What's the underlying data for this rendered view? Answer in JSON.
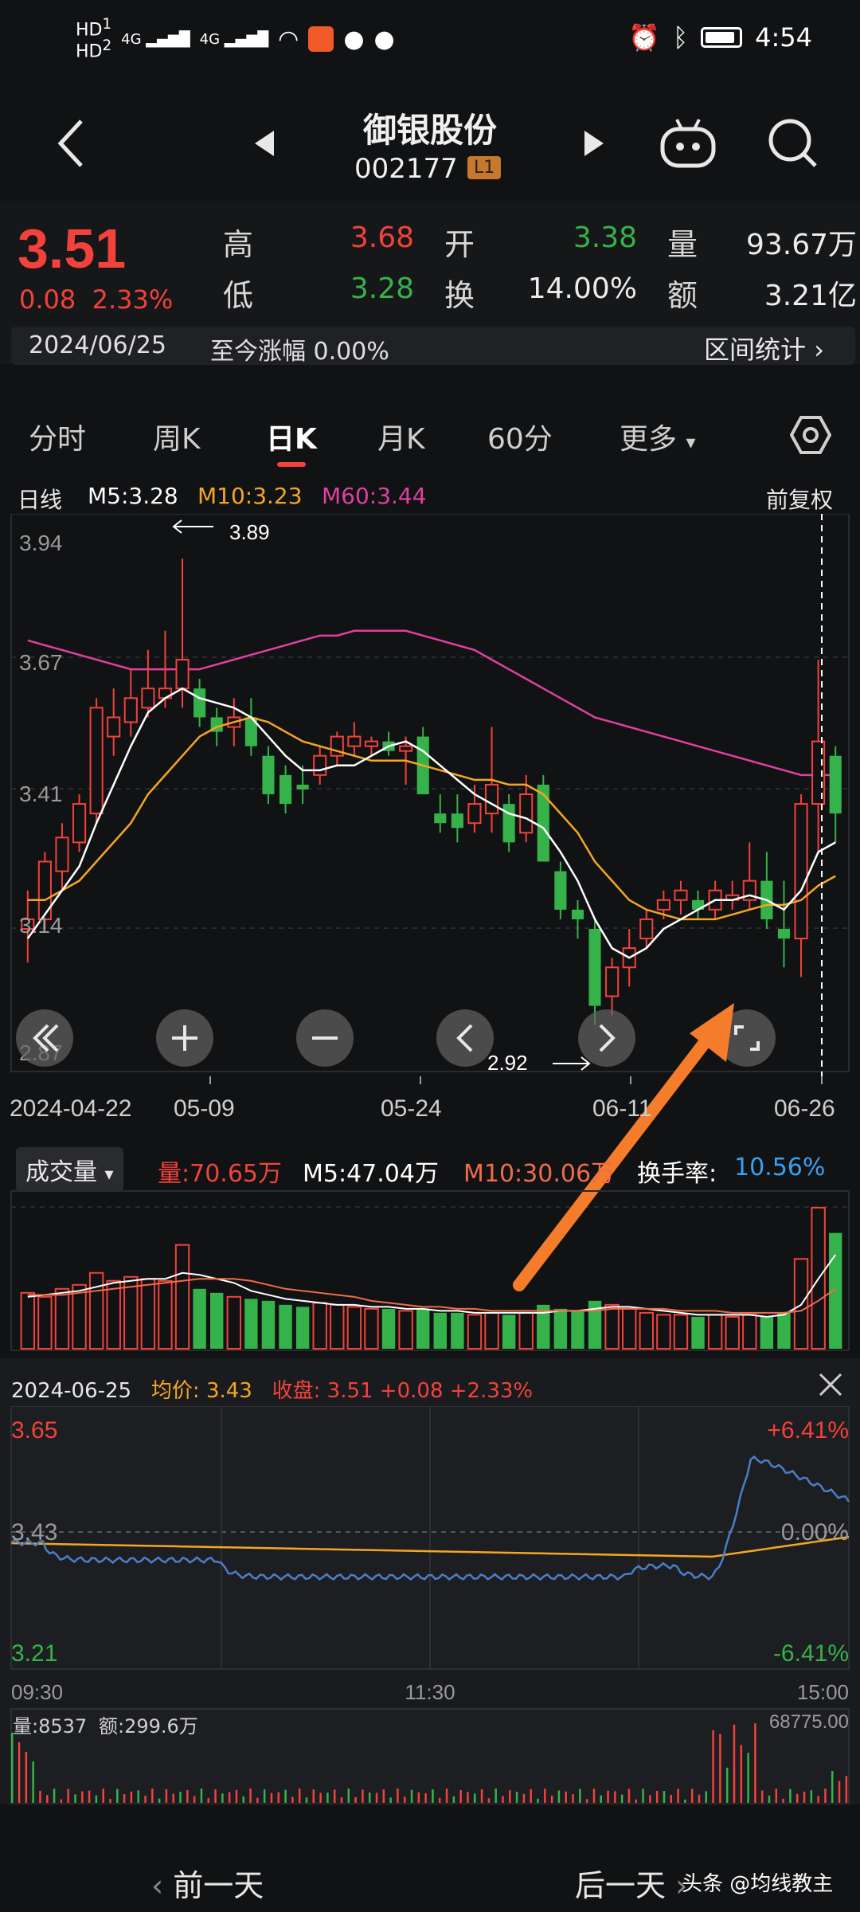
{
  "status_bar": {
    "time": "4:54",
    "network_1": "HD",
    "network_2": "4G",
    "sim1": "1",
    "sim2": "2"
  },
  "header": {
    "stock_name": "御银股份",
    "stock_code": "002177",
    "level_badge": "L1"
  },
  "quote": {
    "price": "3.51",
    "change": "0.08",
    "change_pct": "2.33%",
    "labels": {
      "high": "高",
      "low": "低",
      "open": "开",
      "turnover": "换",
      "volume": "量",
      "amount": "额"
    },
    "high": "3.68",
    "low": "3.28",
    "open": "3.38",
    "turnover_rate": "14.00%",
    "volume": "93.67万",
    "amount": "3.21亿",
    "date": "2024/06/25",
    "since_change": "至今涨幅 0.00%",
    "range_stats": "区间统计"
  },
  "tabs": {
    "items": [
      "分时",
      "周K",
      "日K",
      "月K",
      "60分",
      "更多"
    ],
    "active": "日K"
  },
  "ma_legend": {
    "label": "日线",
    "m5": "M5:3.28",
    "m10": "M10:3.23",
    "m60": "M60:3.44",
    "adjust": "前复权"
  },
  "kline": {
    "y_labels": [
      "3.94",
      "3.67",
      "3.41",
      "3.14",
      "2.87"
    ],
    "x_labels": [
      "2024-04-22",
      "05-09",
      "05-24",
      "06-11",
      "06-26"
    ],
    "max_annotation": "3.89",
    "min_annotation": "2.92"
  },
  "volume_panel": {
    "selector": "成交量",
    "vol": "量:70.65万",
    "m5": "M5:47.04万",
    "m10": "M10:30.06万",
    "turnover_label": "换手率:",
    "turnover_value": "10.56%"
  },
  "intraday": {
    "date": "2024-06-25",
    "avg_label": "均价:",
    "avg_value": "3.43",
    "close_label": "收盘:",
    "close_value": "3.51 +0.08 +2.33%",
    "y_top": "3.65",
    "y_mid": "3.43",
    "y_bot": "3.21",
    "pct_top": "+6.41%",
    "pct_mid": "0.00%",
    "pct_bot": "-6.41%",
    "t_start": "09:30",
    "t_mid": "11:30",
    "t_end": "15:00",
    "vol_label": "量:8537",
    "amount_label": "额:299.6万",
    "vol_max": "68775.00"
  },
  "bottom_nav": {
    "prev": "前一天",
    "next": "后一天",
    "watermark": "头条 @均线教主"
  },
  "colors": {
    "up": "#f2423b",
    "down": "#35b34a",
    "m5": "#ffffff",
    "m10": "#f5a623",
    "m60": "#e040a0",
    "intraday_price": "#4a7fc8",
    "intraday_avg": "#f5a623"
  },
  "chart_data": {
    "type": "candlestick",
    "candles": [
      {
        "o": 3.12,
        "h": 3.2,
        "l": 3.05,
        "c": 3.14
      },
      {
        "o": 3.14,
        "h": 3.28,
        "l": 3.12,
        "c": 3.26
      },
      {
        "o": 3.24,
        "h": 3.34,
        "l": 3.2,
        "c": 3.31
      },
      {
        "o": 3.3,
        "h": 3.4,
        "l": 3.28,
        "c": 3.38
      },
      {
        "o": 3.36,
        "h": 3.6,
        "l": 3.34,
        "c": 3.58
      },
      {
        "o": 3.52,
        "h": 3.62,
        "l": 3.48,
        "c": 3.56
      },
      {
        "o": 3.55,
        "h": 3.66,
        "l": 3.52,
        "c": 3.6
      },
      {
        "o": 3.58,
        "h": 3.7,
        "l": 3.56,
        "c": 3.62
      },
      {
        "o": 3.6,
        "h": 3.74,
        "l": 3.58,
        "c": 3.62
      },
      {
        "o": 3.62,
        "h": 3.89,
        "l": 3.58,
        "c": 3.68
      },
      {
        "o": 3.62,
        "h": 3.64,
        "l": 3.54,
        "c": 3.56
      },
      {
        "o": 3.56,
        "h": 3.58,
        "l": 3.5,
        "c": 3.53
      },
      {
        "o": 3.54,
        "h": 3.6,
        "l": 3.5,
        "c": 3.56
      },
      {
        "o": 3.56,
        "h": 3.6,
        "l": 3.48,
        "c": 3.5
      },
      {
        "o": 3.48,
        "h": 3.5,
        "l": 3.38,
        "c": 3.4
      },
      {
        "o": 3.44,
        "h": 3.46,
        "l": 3.36,
        "c": 3.38
      },
      {
        "o": 3.42,
        "h": 3.46,
        "l": 3.38,
        "c": 3.41
      },
      {
        "o": 3.44,
        "h": 3.5,
        "l": 3.42,
        "c": 3.48
      },
      {
        "o": 3.48,
        "h": 3.53,
        "l": 3.46,
        "c": 3.52
      },
      {
        "o": 3.5,
        "h": 3.55,
        "l": 3.48,
        "c": 3.52
      },
      {
        "o": 3.5,
        "h": 3.52,
        "l": 3.48,
        "c": 3.51
      },
      {
        "o": 3.51,
        "h": 3.53,
        "l": 3.48,
        "c": 3.49
      },
      {
        "o": 3.49,
        "h": 3.52,
        "l": 3.42,
        "c": 3.5
      },
      {
        "o": 3.52,
        "h": 3.54,
        "l": 3.44,
        "c": 3.4
      },
      {
        "o": 3.36,
        "h": 3.4,
        "l": 3.32,
        "c": 3.34
      },
      {
        "o": 3.36,
        "h": 3.4,
        "l": 3.3,
        "c": 3.33
      },
      {
        "o": 3.34,
        "h": 3.42,
        "l": 3.32,
        "c": 3.38
      },
      {
        "o": 3.36,
        "h": 3.54,
        "l": 3.32,
        "c": 3.42
      },
      {
        "o": 3.38,
        "h": 3.4,
        "l": 3.28,
        "c": 3.3
      },
      {
        "o": 3.32,
        "h": 3.44,
        "l": 3.3,
        "c": 3.4
      },
      {
        "o": 3.42,
        "h": 3.44,
        "l": 3.28,
        "c": 3.26
      },
      {
        "o": 3.24,
        "h": 3.26,
        "l": 3.14,
        "c": 3.16
      },
      {
        "o": 3.16,
        "h": 3.18,
        "l": 3.1,
        "c": 3.14
      },
      {
        "o": 3.12,
        "h": 3.14,
        "l": 2.92,
        "c": 2.96
      },
      {
        "o": 2.98,
        "h": 3.06,
        "l": 2.94,
        "c": 3.04
      },
      {
        "o": 3.04,
        "h": 3.12,
        "l": 3.0,
        "c": 3.08
      },
      {
        "o": 3.1,
        "h": 3.16,
        "l": 3.08,
        "c": 3.14
      },
      {
        "o": 3.16,
        "h": 3.2,
        "l": 3.14,
        "c": 3.18
      },
      {
        "o": 3.18,
        "h": 3.22,
        "l": 3.15,
        "c": 3.2
      },
      {
        "o": 3.18,
        "h": 3.2,
        "l": 3.14,
        "c": 3.16
      },
      {
        "o": 3.16,
        "h": 3.22,
        "l": 3.14,
        "c": 3.2
      },
      {
        "o": 3.18,
        "h": 3.22,
        "l": 3.16,
        "c": 3.19
      },
      {
        "o": 3.18,
        "h": 3.3,
        "l": 3.16,
        "c": 3.22
      },
      {
        "o": 3.22,
        "h": 3.28,
        "l": 3.12,
        "c": 3.14
      },
      {
        "o": 3.12,
        "h": 3.22,
        "l": 3.04,
        "c": 3.1
      },
      {
        "o": 3.1,
        "h": 3.4,
        "l": 3.02,
        "c": 3.38
      },
      {
        "o": 3.38,
        "h": 3.68,
        "l": 3.28,
        "c": 3.51
      },
      {
        "o": 3.48,
        "h": 3.5,
        "l": 3.3,
        "c": 3.36
      }
    ],
    "m5": [
      3.1,
      3.15,
      3.2,
      3.25,
      3.34,
      3.42,
      3.5,
      3.57,
      3.6,
      3.62,
      3.6,
      3.59,
      3.58,
      3.56,
      3.52,
      3.48,
      3.45,
      3.45,
      3.46,
      3.46,
      3.48,
      3.5,
      3.51,
      3.49,
      3.46,
      3.43,
      3.4,
      3.38,
      3.36,
      3.35,
      3.33,
      3.28,
      3.22,
      3.14,
      3.08,
      3.06,
      3.08,
      3.12,
      3.14,
      3.16,
      3.18,
      3.18,
      3.19,
      3.18,
      3.16,
      3.2,
      3.28,
      3.3
    ],
    "m10": [
      3.18,
      3.18,
      3.2,
      3.22,
      3.26,
      3.3,
      3.34,
      3.4,
      3.44,
      3.48,
      3.52,
      3.54,
      3.55,
      3.56,
      3.55,
      3.53,
      3.51,
      3.5,
      3.49,
      3.48,
      3.47,
      3.47,
      3.47,
      3.46,
      3.45,
      3.44,
      3.43,
      3.43,
      3.42,
      3.42,
      3.4,
      3.36,
      3.32,
      3.26,
      3.22,
      3.18,
      3.16,
      3.15,
      3.14,
      3.14,
      3.14,
      3.15,
      3.16,
      3.17,
      3.17,
      3.18,
      3.21,
      3.23
    ],
    "m60": [
      3.72,
      3.71,
      3.7,
      3.69,
      3.68,
      3.67,
      3.66,
      3.66,
      3.66,
      3.66,
      3.66,
      3.67,
      3.68,
      3.69,
      3.7,
      3.71,
      3.72,
      3.73,
      3.73,
      3.74,
      3.74,
      3.74,
      3.74,
      3.73,
      3.72,
      3.71,
      3.7,
      3.68,
      3.66,
      3.64,
      3.62,
      3.6,
      3.58,
      3.56,
      3.55,
      3.54,
      3.53,
      3.52,
      3.51,
      3.5,
      3.49,
      3.48,
      3.47,
      3.46,
      3.45,
      3.44,
      3.44,
      3.44
    ],
    "volume": [
      28,
      26,
      30,
      32,
      38,
      34,
      36,
      35,
      34,
      52,
      30,
      28,
      26,
      25,
      24,
      22,
      21,
      23,
      22,
      21,
      20,
      20,
      19,
      20,
      18,
      18,
      17,
      18,
      17,
      18,
      22,
      20,
      19,
      24,
      22,
      20,
      18,
      17,
      17,
      16,
      17,
      16,
      17,
      16,
      18,
      45,
      70.65,
      58
    ],
    "vol_m5": [
      26,
      27,
      28,
      29,
      31,
      33,
      34,
      35,
      35,
      38,
      37,
      35,
      33,
      29,
      27,
      25,
      24,
      23,
      22,
      22,
      21,
      21,
      20,
      20,
      19,
      19,
      18,
      18,
      18,
      18,
      18,
      19,
      19,
      20,
      21,
      21,
      20,
      19,
      18,
      17,
      17,
      17,
      17,
      16,
      17,
      22,
      35,
      47.04
    ],
    "vol_m10": [
      27,
      27,
      27,
      28,
      29,
      30,
      31,
      32,
      33,
      34,
      35,
      35,
      35,
      34,
      32,
      30,
      29,
      28,
      27,
      26,
      24,
      23,
      22,
      21,
      21,
      20,
      20,
      19,
      19,
      19,
      19,
      19,
      19,
      19,
      20,
      20,
      20,
      20,
      19,
      19,
      19,
      18,
      18,
      18,
      18,
      19,
      24,
      30.06
    ]
  }
}
